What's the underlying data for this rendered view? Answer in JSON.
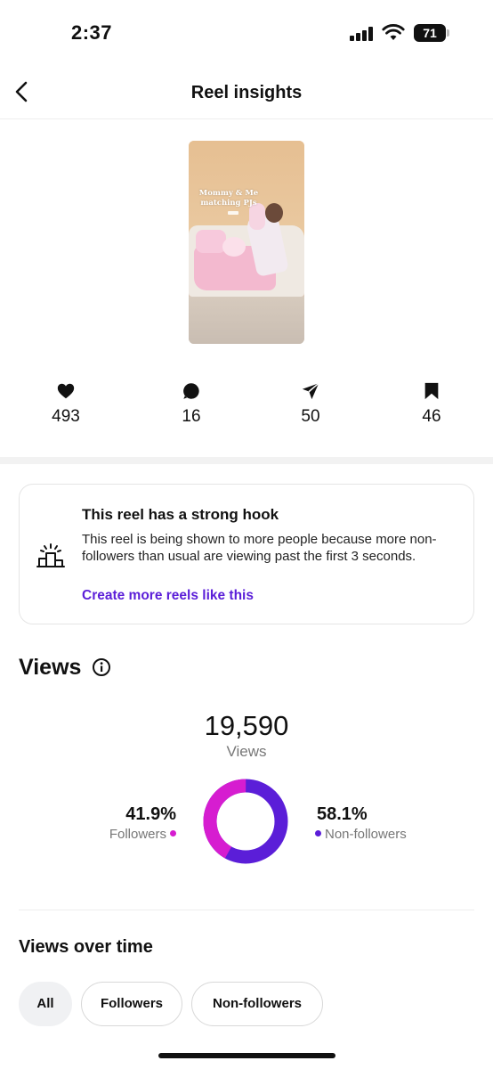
{
  "status_bar": {
    "time": "2:37",
    "battery": "71"
  },
  "header": {
    "title": "Reel insights"
  },
  "reel": {
    "caption_line1": "Mommy & Me",
    "caption_line2": "matching PJs"
  },
  "stats": [
    {
      "icon": "heart-icon",
      "value": "493"
    },
    {
      "icon": "comment-icon",
      "value": "16"
    },
    {
      "icon": "share-icon",
      "value": "50"
    },
    {
      "icon": "save-icon",
      "value": "46"
    }
  ],
  "insight_card": {
    "title": "This reel has a strong hook",
    "body": "This reel is being shown to more people because more non-followers than usual are viewing past the first 3 seconds.",
    "link": "Create more reels like this"
  },
  "views": {
    "title": "Views",
    "total": "19,590",
    "total_label": "Views",
    "followers_pct": "41.9%",
    "followers_label": "Followers",
    "non_followers_pct": "58.1%",
    "non_followers_label": "Non-followers",
    "followers_share": 0.419,
    "colors": {
      "followers": "#d61dd0",
      "non_followers": "#5b1ed8"
    }
  },
  "views_over_time": {
    "title": "Views over time",
    "filters": [
      "All",
      "Followers",
      "Non-followers"
    ],
    "selected": "All"
  }
}
